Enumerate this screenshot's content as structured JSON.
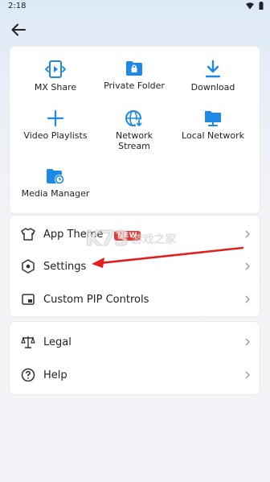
{
  "status": {
    "time": "2:18"
  },
  "grid": {
    "items": [
      {
        "label": "MX Share",
        "icon": "mx-share-icon"
      },
      {
        "label": "Private Folder",
        "icon": "lock-folder-icon"
      },
      {
        "label": "Download",
        "icon": "download-icon"
      },
      {
        "label": "Video Playlists",
        "icon": "plus-icon"
      },
      {
        "label": "Network\nStream",
        "icon": "globe-icon"
      },
      {
        "label": "Local Network",
        "icon": "monitor-icon"
      },
      {
        "label": "Media Manager",
        "icon": "media-folder-icon"
      }
    ]
  },
  "menu": {
    "app_theme": "App Theme",
    "new_badge": "NEW",
    "settings": "Settings",
    "custom_pip": "Custom PIP Controls",
    "legal": "Legal",
    "help": "Help"
  },
  "watermark": {
    "logo": "K73",
    "text": "游戏之家"
  },
  "colors": {
    "accent": "#1e88e5",
    "badge": "#e53935",
    "arrow": "#e0201c"
  }
}
